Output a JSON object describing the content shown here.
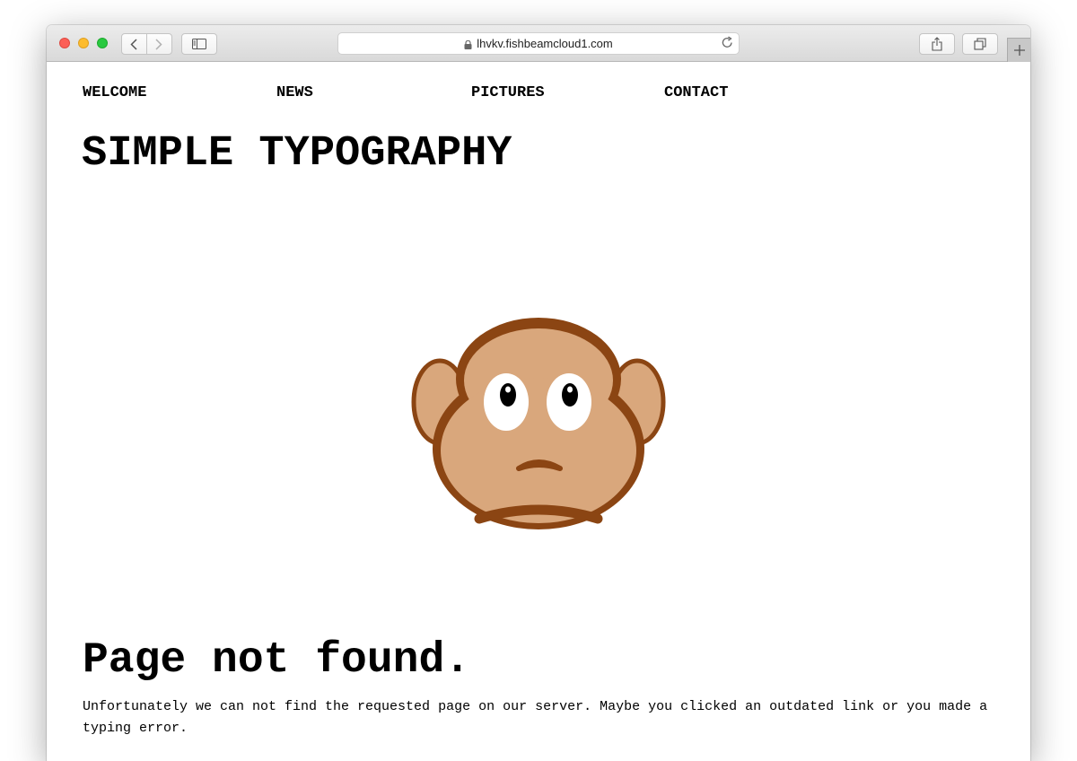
{
  "browser": {
    "url": "lhvkv.fishbeamcloud1.com",
    "icons": {
      "back": "chevron-left-icon",
      "forward": "chevron-right-icon",
      "sidebar": "sidebar-icon",
      "share": "share-icon",
      "tabs": "tabs-icon",
      "new_tab": "plus-icon",
      "reload": "reload-icon",
      "lock": "lock-icon"
    }
  },
  "nav": {
    "items": [
      {
        "label": "WELCOME"
      },
      {
        "label": "NEWS"
      },
      {
        "label": "PICTURES"
      },
      {
        "label": "CONTACT"
      }
    ]
  },
  "site": {
    "title": "SIMPLE TYPOGRAPHY"
  },
  "illustration": {
    "name": "sad-monkey-icon",
    "colors": {
      "outline": "#8b4513",
      "face": "#d9a77c",
      "eye_white": "#ffffff",
      "pupil": "#000000"
    }
  },
  "error": {
    "heading": "Page not found.",
    "message": "Unfortunately we can not find the requested page on our server. Maybe you clicked an outdated link or you made a typing error."
  }
}
